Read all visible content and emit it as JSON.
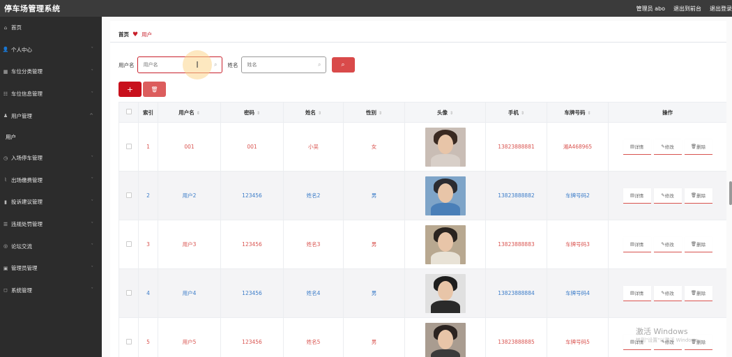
{
  "app": {
    "title": "停车场管理系统"
  },
  "topbar": {
    "links": [
      "管理员 abo",
      "退出到前台",
      "退出登录"
    ]
  },
  "sidebar": {
    "items": [
      {
        "label": "首页",
        "icon": "home-icon",
        "glyph": "⌂",
        "chevron": ""
      },
      {
        "label": "个人中心",
        "icon": "user-icon",
        "glyph": "👤",
        "chevron": "⌄"
      },
      {
        "label": "车位分类管理",
        "icon": "grid-icon",
        "glyph": "▦",
        "chevron": "⌄"
      },
      {
        "label": "车位信息管理",
        "icon": "list-icon",
        "glyph": "☷",
        "chevron": "⌄"
      },
      {
        "label": "用户管理",
        "icon": "users-icon",
        "glyph": "♟",
        "chevron": "⌃"
      },
      {
        "label": "入场停车管理",
        "icon": "clock-icon",
        "glyph": "◷",
        "chevron": "⌄"
      },
      {
        "label": "出场缴费管理",
        "icon": "chart-line-icon",
        "glyph": "⌇",
        "chevron": "⌄"
      },
      {
        "label": "投诉建议管理",
        "icon": "bar-chart-icon",
        "glyph": "▮",
        "chevron": "⌄"
      },
      {
        "label": "违规处罚管理",
        "icon": "menu-icon",
        "glyph": "☰",
        "chevron": "⌄"
      },
      {
        "label": "论坛交流",
        "icon": "circle-icon",
        "glyph": "◎",
        "chevron": "⌄"
      },
      {
        "label": "管理员管理",
        "icon": "admin-icon",
        "glyph": "▣",
        "chevron": "⌄"
      },
      {
        "label": "系统管理",
        "icon": "settings-icon",
        "glyph": "◻",
        "chevron": "⌄"
      }
    ],
    "submenu": {
      "after": 4,
      "label": "用户"
    }
  },
  "breadcrumb": {
    "home": "首页",
    "current": "用户"
  },
  "search": {
    "username_label": "用户名",
    "username_placeholder": "用户名",
    "name_label": "姓名",
    "name_placeholder": "姓名"
  },
  "table": {
    "headers": [
      "",
      "索引",
      "用户名",
      "密码",
      "姓名",
      "性别",
      "头像",
      "手机",
      "车牌号码",
      "操作"
    ],
    "sortable": [
      false,
      false,
      true,
      true,
      true,
      true,
      true,
      true,
      true,
      false
    ],
    "rows": [
      {
        "index": "1",
        "username": "001",
        "password": "001",
        "name": "小吴",
        "gender": "女",
        "phone": "13823888881",
        "plate": "湘A468965",
        "color": "red",
        "avatar": {
          "hair": "#3a2a22",
          "body": "#d8cfc8",
          "bg": "#c9bdb5"
        }
      },
      {
        "index": "2",
        "username": "用户2",
        "password": "123456",
        "name": "姓名2",
        "gender": "男",
        "phone": "13823888882",
        "plate": "车牌号码2",
        "color": "blue",
        "avatar": {
          "hair": "#2b2b30",
          "body": "#4a7fb8",
          "bg": "#7ea4c8"
        }
      },
      {
        "index": "3",
        "username": "用户3",
        "password": "123456",
        "name": "姓名3",
        "gender": "男",
        "phone": "13823888883",
        "plate": "车牌号码3",
        "color": "red",
        "avatar": {
          "hair": "#2a2420",
          "body": "#e8e2d6",
          "bg": "#b8a890"
        }
      },
      {
        "index": "4",
        "username": "用户4",
        "password": "123456",
        "name": "姓名4",
        "gender": "男",
        "phone": "13823888884",
        "plate": "车牌号码4",
        "color": "blue",
        "avatar": {
          "hair": "#1e1e1e",
          "body": "#2a2a2a",
          "bg": "#e0e0e0"
        }
      },
      {
        "index": "5",
        "username": "用户5",
        "password": "123456",
        "name": "姓名5",
        "gender": "男",
        "phone": "13823888885",
        "plate": "车牌号码5",
        "color": "red",
        "avatar": {
          "hair": "#2b2320",
          "body": "#3a3a3a",
          "bg": "#a99c90"
        }
      }
    ],
    "ops": {
      "detail": "详情",
      "edit": "修改",
      "delete": "删除"
    }
  },
  "watermark": {
    "line1": "激活 Windows",
    "line2": "转到\"设置\"以激活 Windows。"
  },
  "colors": {
    "topbar": "#3b3b3b",
    "sidebar": "#2c2c2c",
    "accent": "#c8202b",
    "link_blue": "#3a7bc8"
  }
}
